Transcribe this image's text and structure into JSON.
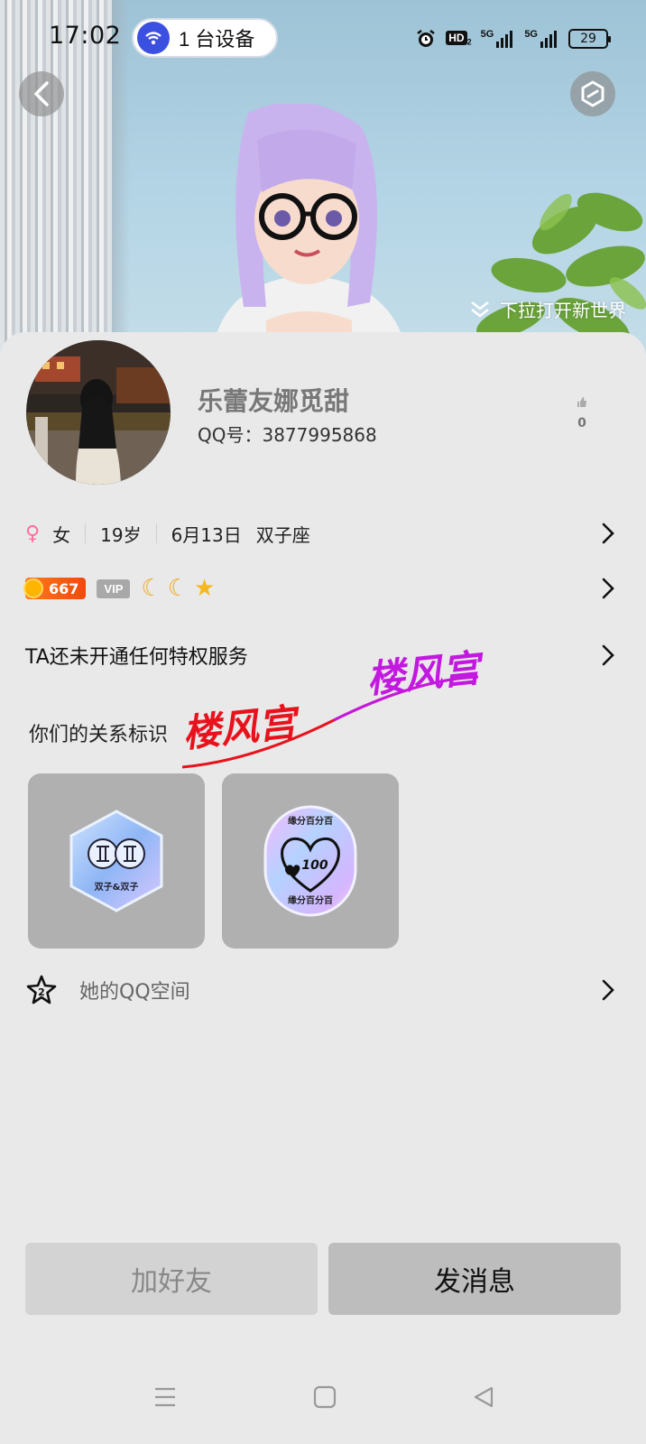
{
  "status_bar": {
    "time": "17:02",
    "devices_pill": "1 台设备",
    "network_labels": [
      "5G",
      "5G"
    ],
    "hd_label": "HD",
    "hd_sub": "2",
    "battery": "29"
  },
  "hero": {
    "pull_hint": "下拉打开新世界"
  },
  "profile": {
    "nickname": "乐蕾友娜觅甜",
    "qq_number": "QQ号：3877995868",
    "like_count": "0"
  },
  "info_row": {
    "gender_symbol": "♀",
    "gender": "女",
    "age": "19岁",
    "birthday": "6月13日",
    "zodiac": "双子座"
  },
  "badges": {
    "coin_count": "667",
    "vip_label": "VIP",
    "level_icons": [
      "☾",
      "☾",
      "★"
    ]
  },
  "privilege": {
    "text": "TA还未开通任何特权服务"
  },
  "relationship": {
    "title": "你们的关系标识",
    "tags": [
      {
        "caption": "双子&双子",
        "symbol": "♊ ♊"
      },
      {
        "caption_top": "缘分百分百",
        "caption_bottom": "缘分百分百",
        "score": "100"
      }
    ]
  },
  "qzone": {
    "label": "她的QQ空间",
    "icon_number": "2"
  },
  "watermarks": [
    "楼风宫",
    "楼风宫"
  ],
  "actions": {
    "add_friend": "加好友",
    "send_message": "发消息"
  },
  "colors": {
    "accent_female": "#ff6ea0",
    "coin": "#f04a0c",
    "watermark_red": "#e8121c",
    "watermark_purple": "#c318e0"
  }
}
